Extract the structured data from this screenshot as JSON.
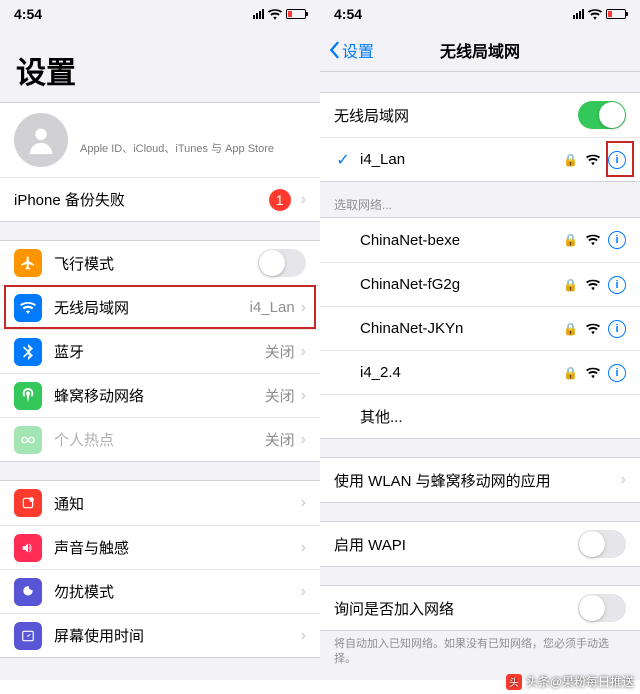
{
  "status": {
    "time": "4:54"
  },
  "left": {
    "bigtitle": "设置",
    "account_sub": "Apple ID、iCloud、iTunes 与 App Store",
    "backup_label": "iPhone 备份失败",
    "backup_badge": "1",
    "airplane": "飞行模式",
    "wifi": "无线局域网",
    "wifi_detail": "i4_Lan",
    "bt": "蓝牙",
    "bt_detail": "关闭",
    "cellular": "蜂窝移动网络",
    "cellular_detail": "关闭",
    "hotspot": "个人热点",
    "hotspot_detail": "关闭",
    "notif": "通知",
    "sounds": "声音与触感",
    "dnd": "勿扰模式",
    "screentime": "屏幕使用时间"
  },
  "right": {
    "back": "设置",
    "title": "无线局域网",
    "switch_label": "无线局域网",
    "connected": "i4_Lan",
    "choose_header": "选取网络...",
    "networks": [
      {
        "name": "ChinaNet-bexe"
      },
      {
        "name": "ChinaNet-fG2g"
      },
      {
        "name": "ChinaNet-JKYn"
      },
      {
        "name": "i4_2.4"
      }
    ],
    "other": "其他...",
    "apps_label": "使用 WLAN 与蜂窝移动网的应用",
    "wapi_label": "启用 WAPI",
    "ask_label": "询问是否加入网络",
    "ask_footer": "将自动加入已知网络。如果没有已知网络，您必须手动选择。"
  },
  "watermark": "头条@果粉每日推送"
}
